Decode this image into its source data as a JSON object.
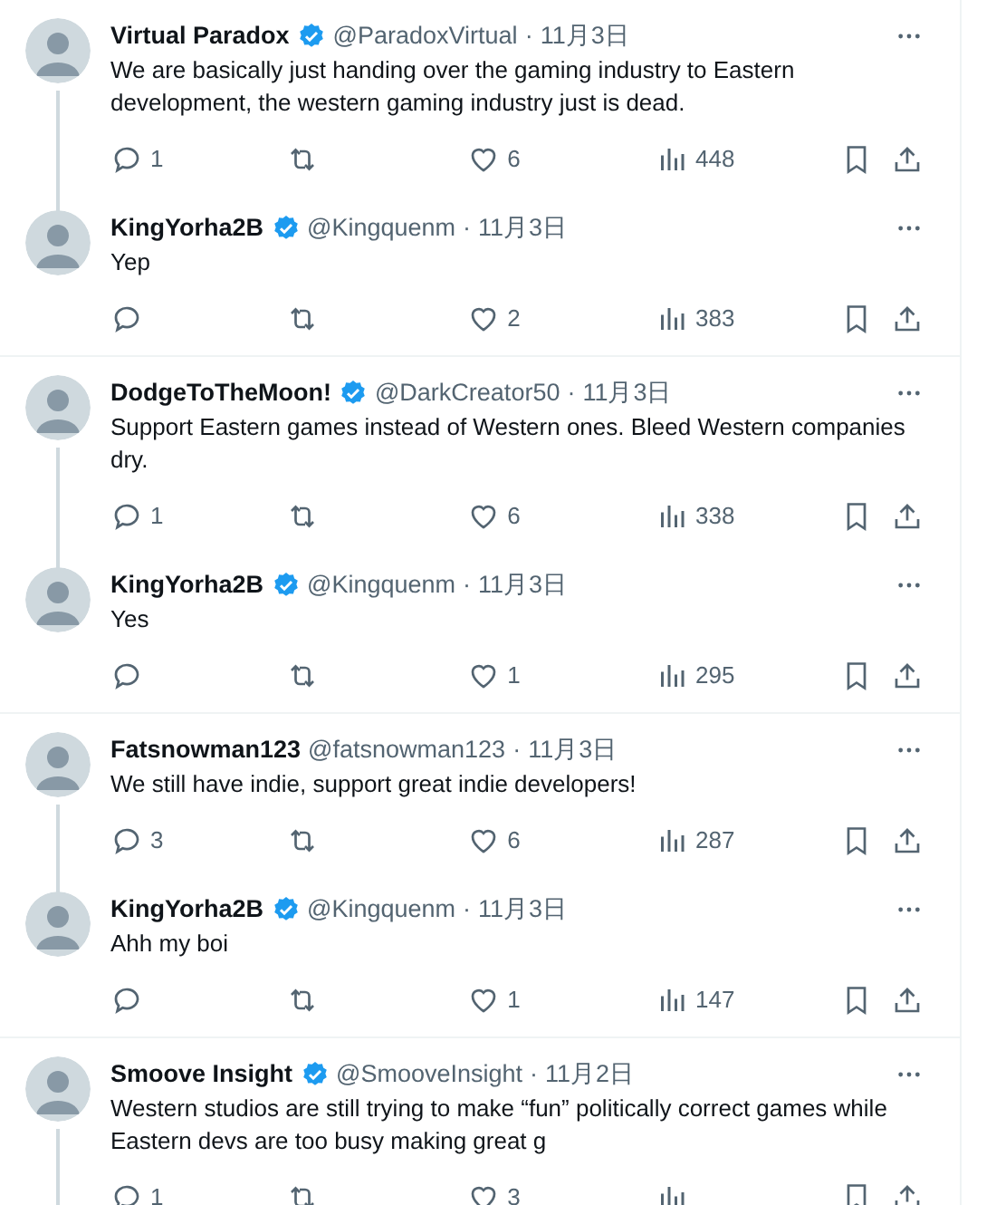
{
  "threads": [
    {
      "continues": false,
      "posts": [
        {
          "name": "Virtual Paradox",
          "verified": true,
          "handle": "@ParadoxVirtual",
          "separator": "·",
          "date": "11月3日",
          "text": "We are basically just handing over the gaming industry to Eastern development, the western gaming industry just is dead.",
          "replies": "1",
          "likes": "6",
          "views": "448"
        },
        {
          "name": "KingYorha2B",
          "verified": true,
          "handle": "@Kingquenm",
          "separator": "·",
          "date": "11月3日",
          "text": "Yep",
          "likes": "2",
          "views": "383"
        }
      ]
    },
    {
      "continues": false,
      "posts": [
        {
          "name": "DodgeToTheMoon!",
          "verified": true,
          "handle": "@DarkCreator50",
          "separator": "·",
          "date": "11月3日",
          "text": "Support Eastern games instead of Western ones. Bleed Western companies dry.",
          "replies": "1",
          "likes": "6",
          "views": "338"
        },
        {
          "name": "KingYorha2B",
          "verified": true,
          "handle": "@Kingquenm",
          "separator": "·",
          "date": "11月3日",
          "text": "Yes",
          "likes": "1",
          "views": "295"
        }
      ]
    },
    {
      "continues": false,
      "posts": [
        {
          "name": "Fatsnowman123",
          "verified": false,
          "handle": "@fatsnowman123",
          "separator": "·",
          "date": "11月3日",
          "text": "We still have indie, support great indie developers!",
          "replies": "3",
          "likes": "6",
          "views": "287"
        },
        {
          "name": "KingYorha2B",
          "verified": true,
          "handle": "@Kingquenm",
          "separator": "·",
          "date": "11月3日",
          "text": "Ahh my boi",
          "likes": "1",
          "views": "147"
        }
      ]
    },
    {
      "continues": true,
      "posts": [
        {
          "name": "Smoove Insight",
          "verified": true,
          "handle": "@SmooveInsight",
          "separator": "·",
          "date": "11月2日",
          "text": "Western studios are still trying to make “fun” politically correct games while Eastern devs are too busy making great g",
          "replies": "1",
          "likes": "3"
        }
      ]
    }
  ]
}
